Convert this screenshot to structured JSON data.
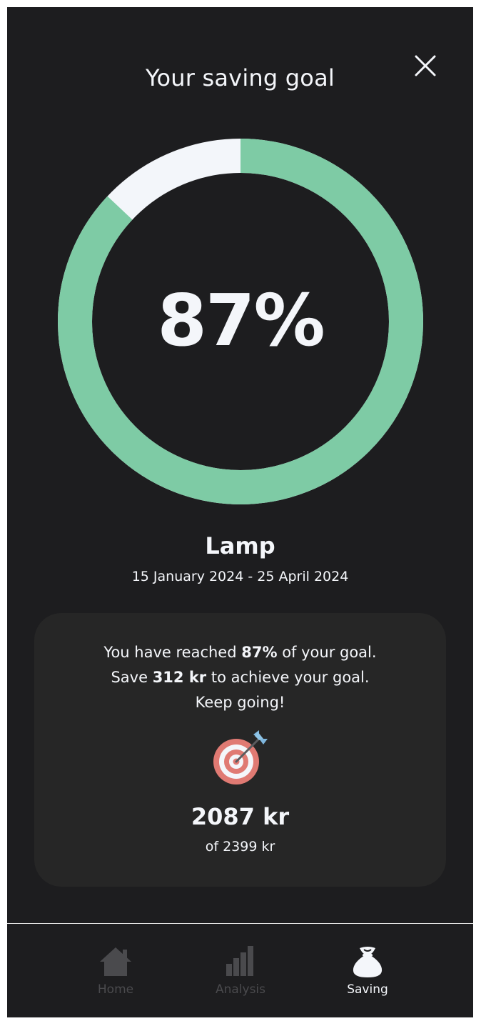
{
  "header": {
    "title": "Your saving goal",
    "close_icon": "close-icon"
  },
  "progress": {
    "percent_label": "87%",
    "fraction": 0.87,
    "fill_color": "#7ecba5",
    "track_color": "#f3f6fa"
  },
  "goal": {
    "name": "Lamp",
    "dates": "15 January 2024 - 25 April 2024"
  },
  "card": {
    "line1_prefix": "You have reached ",
    "line1_bold": "87%",
    "line1_suffix": " of your goal.",
    "line2_prefix": "Save ",
    "line2_bold": "312 kr",
    "line2_suffix": " to achieve your goal.",
    "line3": "Keep going!",
    "icon": "target-icon",
    "amount": "2087 kr",
    "of_total": "of 2399 kr"
  },
  "nav": {
    "items": [
      {
        "label": "Home",
        "icon": "home-icon",
        "active": false
      },
      {
        "label": "Analysis",
        "icon": "bar-chart-icon",
        "active": false
      },
      {
        "label": "Saving",
        "icon": "money-bag-icon",
        "active": true
      }
    ]
  },
  "colors": {
    "background": "#1d1d1f",
    "card": "#262626",
    "text": "#f4f6fa",
    "accent": "#7ecba5",
    "inactive": "#4a4a4d"
  }
}
